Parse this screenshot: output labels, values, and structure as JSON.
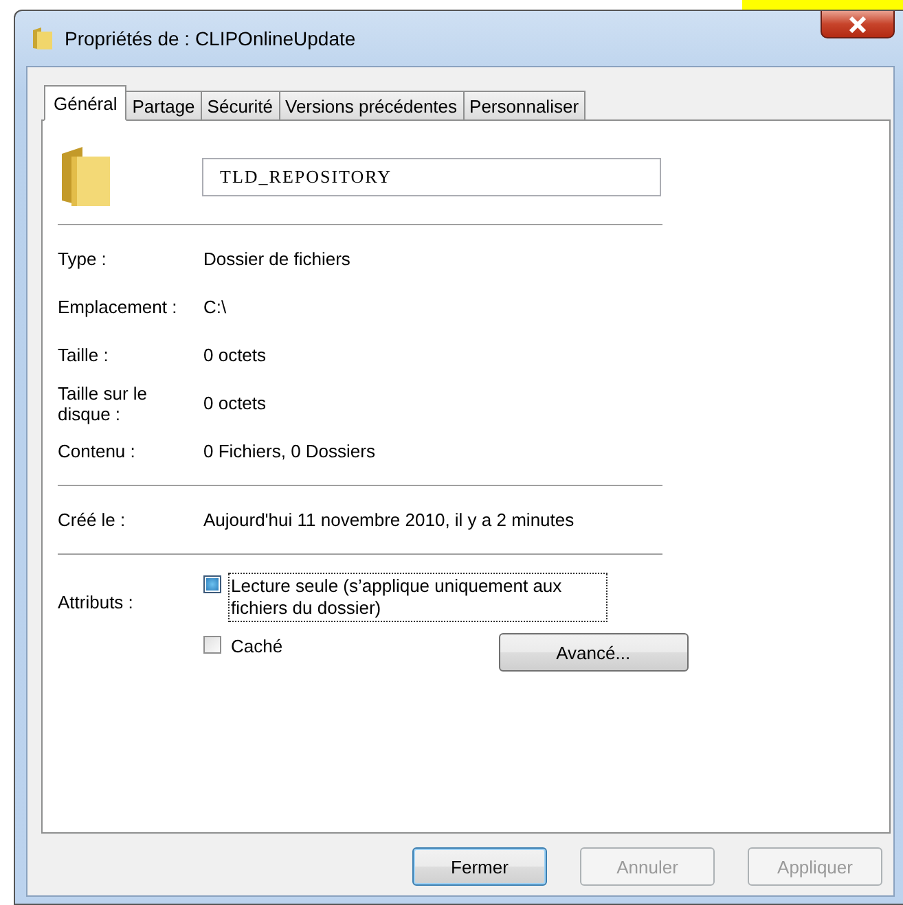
{
  "window": {
    "title": "Propriétés de : CLIPOnlineUpdate"
  },
  "tabs": [
    {
      "label": "Général",
      "selected": true
    },
    {
      "label": "Partage",
      "selected": false
    },
    {
      "label": "Sécurité",
      "selected": false
    },
    {
      "label": "Versions précédentes",
      "selected": false
    },
    {
      "label": "Personnaliser",
      "selected": false
    }
  ],
  "name_field": {
    "value": "TLD_REPOSITORY"
  },
  "sections": [
    [
      {
        "label": "Type :",
        "value": "Dossier de fichiers"
      },
      {
        "label": "Emplacement :",
        "value": "C:\\"
      },
      {
        "label": "Taille :",
        "value": "0 octets"
      },
      {
        "label": "Taille sur le disque :",
        "value": "0 octets"
      },
      {
        "label": "Contenu :",
        "value": "0 Fichiers, 0 Dossiers"
      }
    ],
    [
      {
        "label": "Créé le :",
        "value": "Aujourd'hui 11 novembre 2010, il y a 2 minutes"
      }
    ]
  ],
  "attributes": {
    "label": "Attributs :",
    "options": [
      {
        "label": "Lecture seule (s’applique uniquement aux fichiers du dossier)",
        "checked": true,
        "focused": true
      },
      {
        "label": "Caché",
        "checked": false,
        "focused": false
      }
    ],
    "advanced_button": "Avancé..."
  },
  "buttons": [
    {
      "label": "Fermer",
      "disabled": false,
      "default": true
    },
    {
      "label": "Annuler",
      "disabled": true,
      "default": false
    },
    {
      "label": "Appliquer",
      "disabled": true,
      "default": false
    }
  ]
}
